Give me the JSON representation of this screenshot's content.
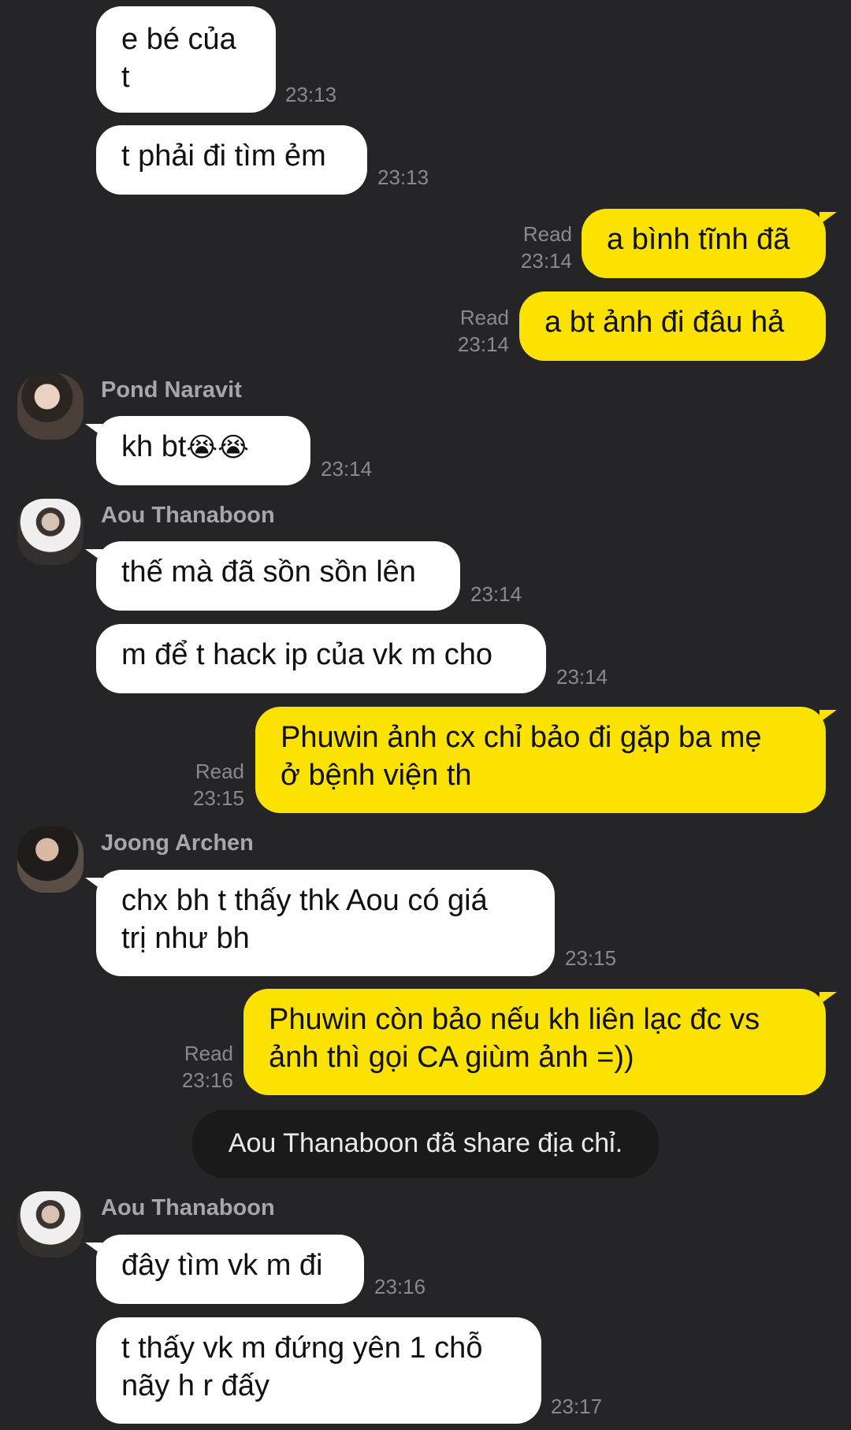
{
  "messages": [
    {
      "text_l1": "e bé của",
      "text_l2": "t",
      "time": "23:13"
    },
    {
      "text": "t phải đi tìm ẻm",
      "time": "23:13"
    },
    {
      "text": "a bình tĩnh đã",
      "status": "Read",
      "time": "23:14"
    },
    {
      "text": "a bt ảnh đi đâu hả",
      "status": "Read",
      "time": "23:14"
    },
    {
      "sender": "Pond Naravit",
      "text": "kh bt",
      "emoji": "😭😭",
      "time": "23:14"
    },
    {
      "sender": "Aou Thanaboon",
      "text": "thế mà đã sồn sồn lên",
      "time": "23:14"
    },
    {
      "text": "m để t hack ip của vk m cho",
      "time": "23:14"
    },
    {
      "text_l1": "Phuwin ảnh cx chỉ bảo đi gặp ba mẹ",
      "text_l2": "ở bệnh viện th",
      "status": "Read",
      "time": "23:15"
    },
    {
      "sender": "Joong Archen",
      "text_l1": "chx bh t thấy thk Aou có giá",
      "text_l2": "trị như bh",
      "time": "23:15"
    },
    {
      "text_l1": "Phuwin còn bảo nếu kh liên lạc đc vs",
      "text_l2": "ảnh thì gọi CA giùm ảnh =))",
      "status": "Read",
      "time": "23:16"
    },
    {
      "notice": "Aou Thanaboon đã share địa chỉ."
    },
    {
      "sender": "Aou Thanaboon",
      "text": "đây tìm vk m đi",
      "time": "23:16"
    },
    {
      "text_l1": "t thấy vk m đứng yên 1 chỗ",
      "text_l2": "nãy h r đấy",
      "time": "23:17"
    }
  ],
  "colors": {
    "background": "#252527",
    "incoming_bubble": "#ffffff",
    "outgoing_bubble": "#fbe200",
    "system_notice": "#1a1a1b"
  }
}
